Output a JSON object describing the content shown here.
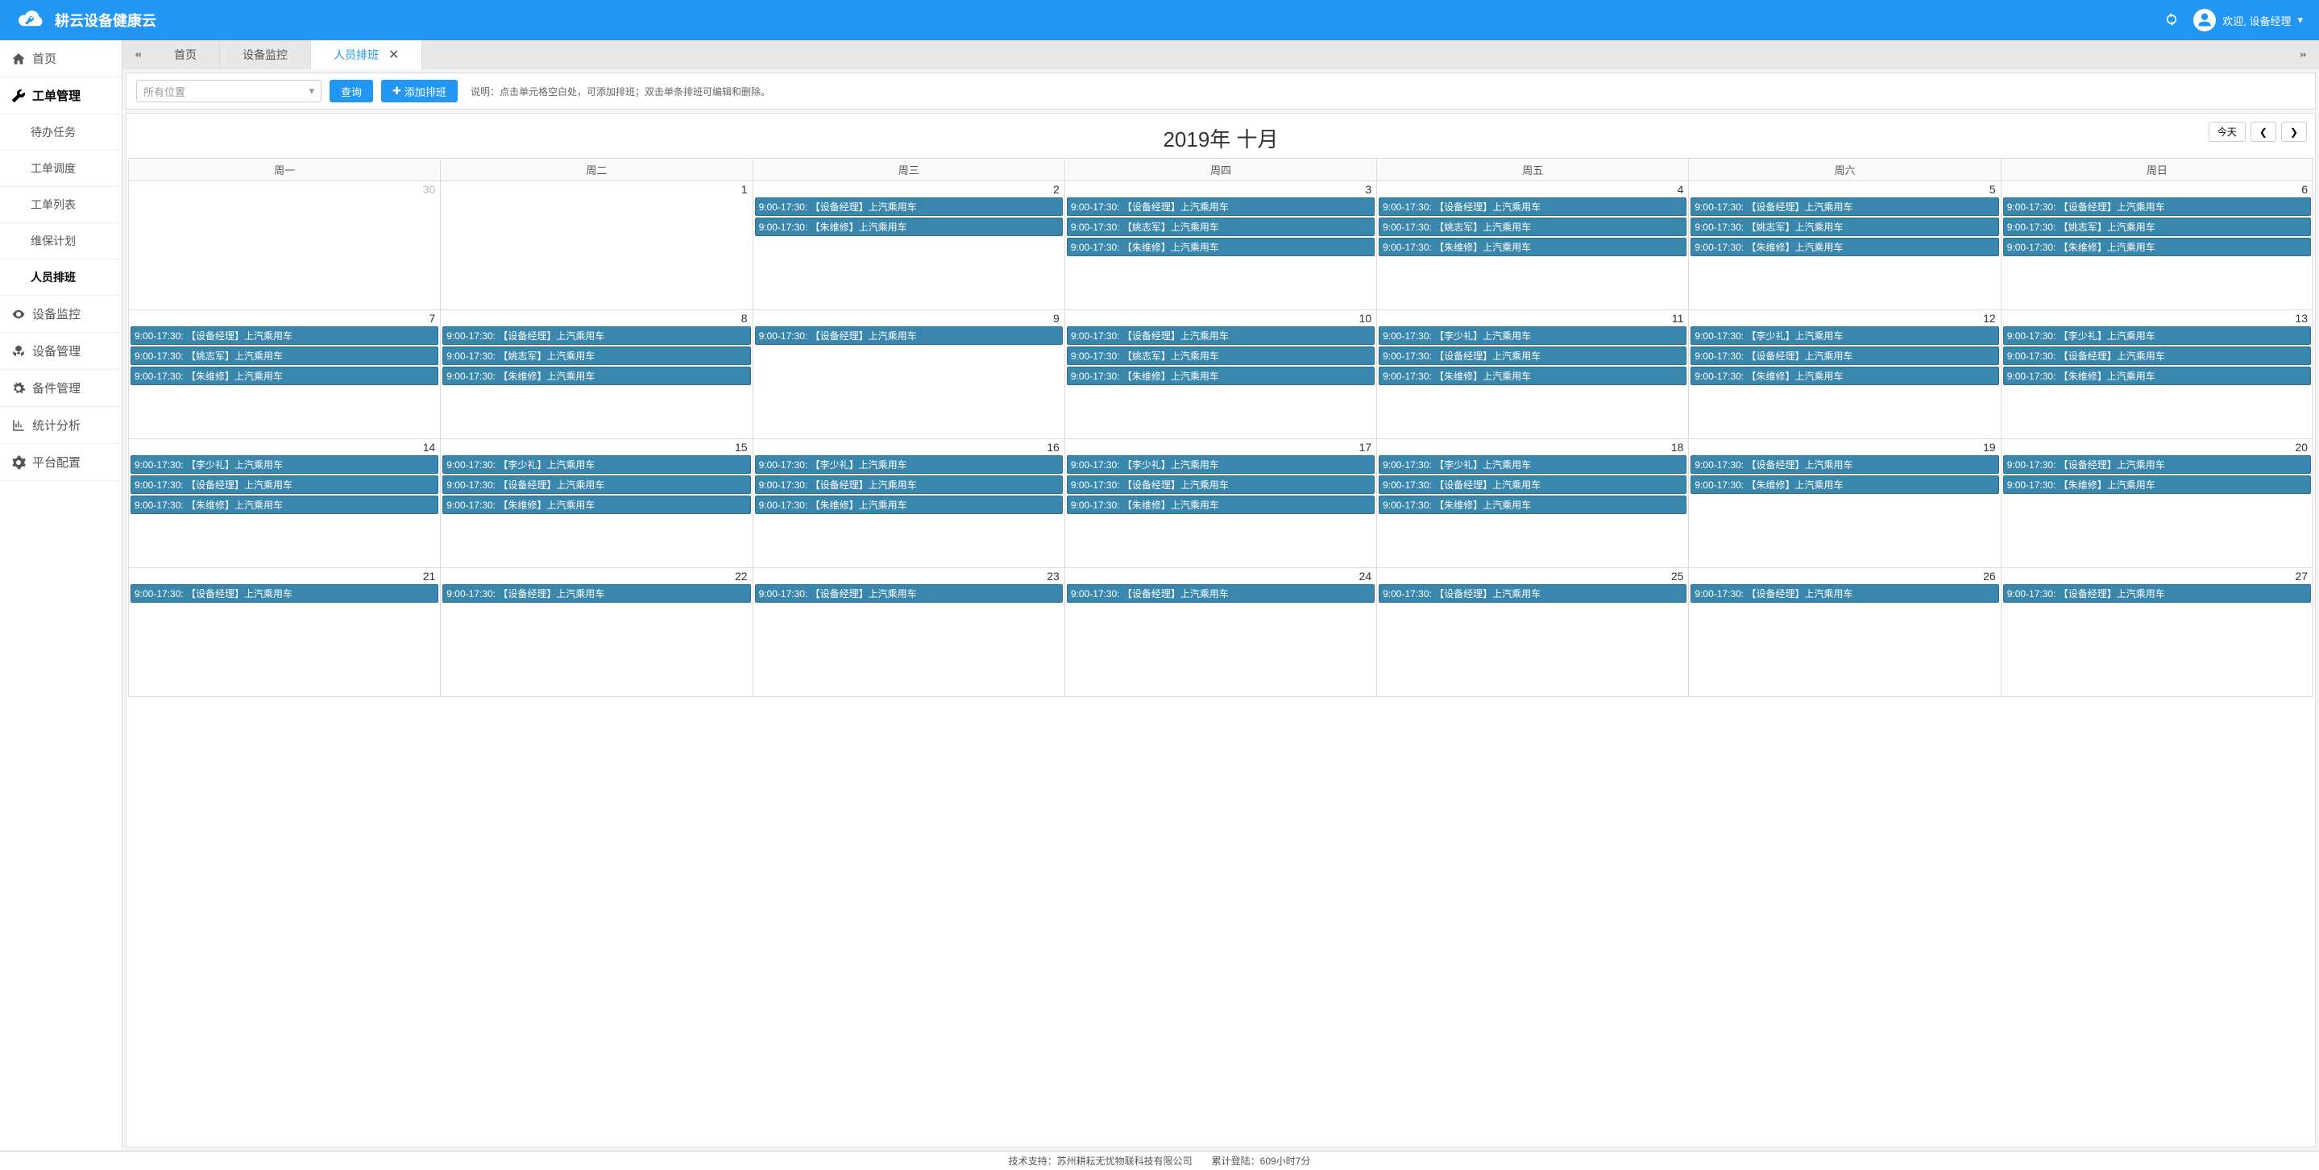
{
  "header": {
    "app_title": "耕云设备健康云",
    "welcome_prefix": "欢迎,",
    "user_name": "设备经理"
  },
  "sidebar": {
    "items": [
      {
        "icon": "home",
        "label": "首页"
      },
      {
        "icon": "wrench",
        "label": "工单管理",
        "active": true,
        "children": [
          {
            "label": "待办任务"
          },
          {
            "label": "工单调度"
          },
          {
            "label": "工单列表"
          },
          {
            "label": "维保计划"
          },
          {
            "label": "人员排班",
            "active": true
          }
        ]
      },
      {
        "icon": "eye",
        "label": "设备监控"
      },
      {
        "icon": "cubes",
        "label": "设备管理"
      },
      {
        "icon": "gear",
        "label": "备件管理"
      },
      {
        "icon": "chart",
        "label": "统计分析"
      },
      {
        "icon": "cog",
        "label": "平台配置"
      }
    ]
  },
  "tabs": {
    "items": [
      {
        "label": "首页"
      },
      {
        "label": "设备监控"
      },
      {
        "label": "人员排班",
        "active": true,
        "closable": true
      }
    ]
  },
  "toolbar": {
    "location_placeholder": "所有位置",
    "query_label": "查询",
    "add_label": "添加排班",
    "hint_prefix": "说明：",
    "hint_text": "点击单元格空白处，可添加排班；双击单条排班可编辑和删除。"
  },
  "calendar": {
    "title": "2019年 十月",
    "today_label": "今天",
    "weekdays": [
      "周一",
      "周二",
      "周三",
      "周四",
      "周五",
      "周六",
      "周日"
    ],
    "days": [
      {
        "num": "30",
        "other": true,
        "events": []
      },
      {
        "num": "1",
        "events": []
      },
      {
        "num": "2",
        "events": [
          "9:00-17:30: 【设备经理】上汽乘用车",
          "9:00-17:30: 【朱维修】上汽乘用车"
        ]
      },
      {
        "num": "3",
        "events": [
          "9:00-17:30: 【设备经理】上汽乘用车",
          "9:00-17:30: 【姚志军】上汽乘用车",
          "9:00-17:30: 【朱维修】上汽乘用车"
        ]
      },
      {
        "num": "4",
        "events": [
          "9:00-17:30: 【设备经理】上汽乘用车",
          "9:00-17:30: 【姚志军】上汽乘用车",
          "9:00-17:30: 【朱维修】上汽乘用车"
        ]
      },
      {
        "num": "5",
        "events": [
          "9:00-17:30: 【设备经理】上汽乘用车",
          "9:00-17:30: 【姚志军】上汽乘用车",
          "9:00-17:30: 【朱维修】上汽乘用车"
        ]
      },
      {
        "num": "6",
        "events": [
          "9:00-17:30: 【设备经理】上汽乘用车",
          "9:00-17:30: 【姚志军】上汽乘用车",
          "9:00-17:30: 【朱维修】上汽乘用车"
        ]
      },
      {
        "num": "7",
        "events": [
          "9:00-17:30: 【设备经理】上汽乘用车",
          "9:00-17:30: 【姚志军】上汽乘用车",
          "9:00-17:30: 【朱维修】上汽乘用车"
        ]
      },
      {
        "num": "8",
        "events": [
          "9:00-17:30: 【设备经理】上汽乘用车",
          "9:00-17:30: 【姚志军】上汽乘用车",
          "9:00-17:30: 【朱维修】上汽乘用车"
        ]
      },
      {
        "num": "9",
        "events": [
          "9:00-17:30: 【设备经理】上汽乘用车"
        ]
      },
      {
        "num": "10",
        "events": [
          "9:00-17:30: 【设备经理】上汽乘用车",
          "9:00-17:30: 【姚志军】上汽乘用车",
          "9:00-17:30: 【朱维修】上汽乘用车"
        ]
      },
      {
        "num": "11",
        "events": [
          "9:00-17:30: 【李少礼】上汽乘用车",
          "9:00-17:30: 【设备经理】上汽乘用车",
          "9:00-17:30: 【朱维修】上汽乘用车"
        ]
      },
      {
        "num": "12",
        "events": [
          "9:00-17:30: 【李少礼】上汽乘用车",
          "9:00-17:30: 【设备经理】上汽乘用车",
          "9:00-17:30: 【朱维修】上汽乘用车"
        ]
      },
      {
        "num": "13",
        "events": [
          "9:00-17:30: 【李少礼】上汽乘用车",
          "9:00-17:30: 【设备经理】上汽乘用车",
          "9:00-17:30: 【朱维修】上汽乘用车"
        ]
      },
      {
        "num": "14",
        "events": [
          "9:00-17:30: 【李少礼】上汽乘用车",
          "9:00-17:30: 【设备经理】上汽乘用车",
          "9:00-17:30: 【朱维修】上汽乘用车"
        ]
      },
      {
        "num": "15",
        "events": [
          "9:00-17:30: 【李少礼】上汽乘用车",
          "9:00-17:30: 【设备经理】上汽乘用车",
          "9:00-17:30: 【朱维修】上汽乘用车"
        ]
      },
      {
        "num": "16",
        "events": [
          "9:00-17:30: 【李少礼】上汽乘用车",
          "9:00-17:30: 【设备经理】上汽乘用车",
          "9:00-17:30: 【朱维修】上汽乘用车"
        ]
      },
      {
        "num": "17",
        "events": [
          "9:00-17:30: 【李少礼】上汽乘用车",
          "9:00-17:30: 【设备经理】上汽乘用车",
          "9:00-17:30: 【朱维修】上汽乘用车"
        ]
      },
      {
        "num": "18",
        "events": [
          "9:00-17:30: 【李少礼】上汽乘用车",
          "9:00-17:30: 【设备经理】上汽乘用车",
          "9:00-17:30: 【朱维修】上汽乘用车"
        ]
      },
      {
        "num": "19",
        "events": [
          "9:00-17:30: 【设备经理】上汽乘用车",
          "9:00-17:30: 【朱维修】上汽乘用车"
        ]
      },
      {
        "num": "20",
        "events": [
          "9:00-17:30: 【设备经理】上汽乘用车",
          "9:00-17:30: 【朱维修】上汽乘用车"
        ]
      },
      {
        "num": "21",
        "events": [
          "9:00-17:30: 【设备经理】上汽乘用车"
        ]
      },
      {
        "num": "22",
        "events": [
          "9:00-17:30: 【设备经理】上汽乘用车"
        ]
      },
      {
        "num": "23",
        "events": [
          "9:00-17:30: 【设备经理】上汽乘用车"
        ]
      },
      {
        "num": "24",
        "events": [
          "9:00-17:30: 【设备经理】上汽乘用车"
        ]
      },
      {
        "num": "25",
        "events": [
          "9:00-17:30: 【设备经理】上汽乘用车"
        ]
      },
      {
        "num": "26",
        "events": [
          "9:00-17:30: 【设备经理】上汽乘用车"
        ]
      },
      {
        "num": "27",
        "events": [
          "9:00-17:30: 【设备经理】上汽乘用车"
        ]
      }
    ]
  },
  "footer": {
    "support_prefix": "技术支持：",
    "support_company": "苏州耕耘无忧物联科技有限公司",
    "login_prefix": "累计登陆：",
    "login_time": "609小时7分"
  }
}
